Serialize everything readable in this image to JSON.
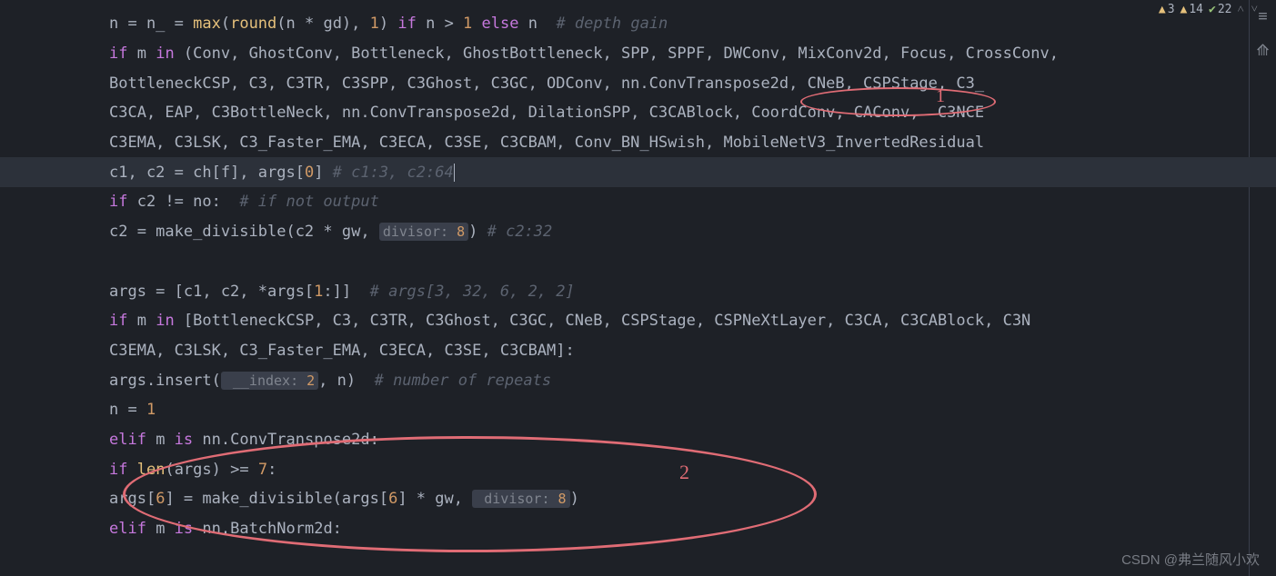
{
  "status": {
    "warn1": "3",
    "warn2": "14",
    "check": "22"
  },
  "code": {
    "l1_a": "n = n_ = ",
    "l1_max": "max",
    "l1_b": "(",
    "l1_round": "round",
    "l1_c": "(n * gd), ",
    "l1_one": "1",
    "l1_d": ") ",
    "l1_if": "if",
    "l1_e": " n > ",
    "l1_one2": "1",
    "l1_f": " ",
    "l1_else": "else",
    "l1_g": " n  ",
    "l1_cmt": "# depth gain",
    "l2_if": "if",
    "l2_a": " m ",
    "l2_in": "in",
    "l2_b": " (Conv, GhostConv, Bottleneck, GhostBottleneck, SPP, SPPF, DWConv, MixConv2d, Focus, CrossConv,",
    "l3": "BottleneckCSP, C3, C3TR, C3SPP, C3Ghost, C3GC, ODConv, nn.ConvTranspose2d, CNeB, CSPStage, C3_",
    "l4": "C3CA, EAP, C3BottleNeck, nn.ConvTranspose2d, DilationSPP, C3CABlock, CoordConv, CAConv,  C3NCE",
    "l5": "C3EMA, C3LSK, C3_Faster_EMA, C3ECA, C3SE, C3CBAM, Conv_BN_HSwish, MobileNetV3_InvertedResidual",
    "l6_a": "c1, c2 = ch[f], args[",
    "l6_zero": "0",
    "l6_b": "] ",
    "l6_cmt": "# c1:3, c2:64",
    "l7_if": "if",
    "l7_a": " c2 != no:  ",
    "l7_cmt": "# if not output",
    "l8_a": "c2 = make_divisible(c2 * gw, ",
    "l8_hint1": "divisor: ",
    "l8_hint2": "8",
    "l8_b": ") ",
    "l8_cmt": "# c2:32",
    "l10_a": "args = [c1, c2, *args[",
    "l10_one": "1",
    "l10_b": ":]]  ",
    "l10_cmt": "# args[3, 32, 6, 2, 2]",
    "l11_if": "if",
    "l11_a": " m ",
    "l11_in": "in",
    "l11_b": " [BottleneckCSP, C3, C3TR, C3Ghost, C3GC, CNeB, CSPStage, CSPNeXtLayer, C3CA, C3CABlock, C3N",
    "l12": "C3EMA, C3LSK, C3_Faster_EMA, C3ECA, C3SE, C3CBAM]:",
    "l13_a": "args.insert(",
    "l13_hint1": " __index: ",
    "l13_hint2": "2",
    "l13_b": ", n)  ",
    "l13_cmt": "# number of repeats",
    "l14_a": "n = ",
    "l14_one": "1",
    "l15_elif": "elif",
    "l15_a": " m ",
    "l15_is": "is",
    "l15_b": " nn.ConvTranspose2d:",
    "l16_if": "if",
    "l16_a": " ",
    "l16_len": "len",
    "l16_b": "(args) >= ",
    "l16_seven": "7",
    "l16_c": ":",
    "l17_a": "args[",
    "l17_six": "6",
    "l17_b": "] = make_divisible(args[",
    "l17_six2": "6",
    "l17_c": "] * gw, ",
    "l17_hint1": " divisor: ",
    "l17_hint2": "8",
    "l17_d": ")",
    "l18_elif": "elif",
    "l18_a": " m ",
    "l18_is": "is",
    "l18_b": " nn.BatchNorm2d:"
  },
  "annotations": {
    "a1": "1",
    "a2": "2"
  },
  "watermark": "CSDN @弗兰随风小欢"
}
